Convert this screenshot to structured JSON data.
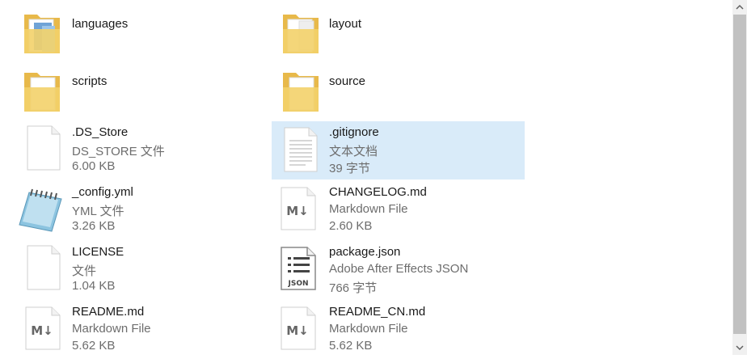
{
  "items": [
    {
      "name": "languages",
      "type": "",
      "size": ""
    },
    {
      "name": "layout",
      "type": "",
      "size": ""
    },
    {
      "name": "scripts",
      "type": "",
      "size": ""
    },
    {
      "name": "source",
      "type": "",
      "size": ""
    },
    {
      "name": ".DS_Store",
      "type": "DS_STORE 文件",
      "size": "6.00 KB"
    },
    {
      "name": ".gitignore",
      "type": "文本文档",
      "size": "39 字节"
    },
    {
      "name": "_config.yml",
      "type": "YML 文件",
      "size": "3.26 KB"
    },
    {
      "name": "CHANGELOG.md",
      "type": "Markdown File",
      "size": "2.60 KB"
    },
    {
      "name": "LICENSE",
      "type": "文件",
      "size": "1.04 KB"
    },
    {
      "name": "package.json",
      "type": "Adobe After Effects JSON",
      "size": "766 字节"
    },
    {
      "name": "README.md",
      "type": "Markdown File",
      "size": "5.62 KB"
    },
    {
      "name": "README_CN.md",
      "type": "Markdown File",
      "size": "5.62 KB"
    }
  ],
  "icons": {
    "json_label": "JSON",
    "md_label": "M↓"
  },
  "colors": {
    "selection": "#d9ebf9",
    "folder": "#f3d26a"
  }
}
